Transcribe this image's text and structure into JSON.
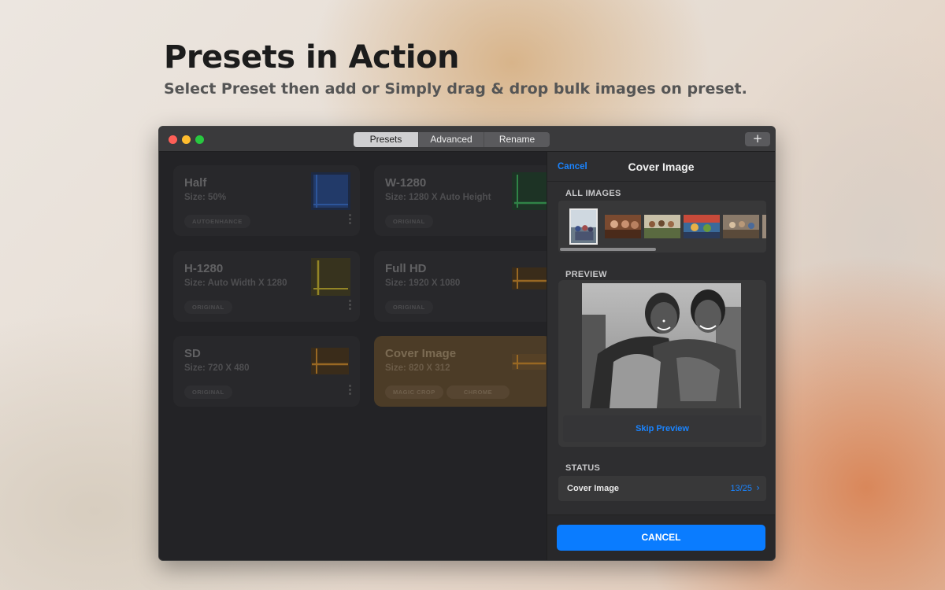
{
  "headline": {
    "title": "Presets in Action",
    "subtitle": "Select Preset then add or Simply drag & drop bulk images on preset."
  },
  "window": {
    "tabs": [
      {
        "label": "Presets",
        "active": true
      },
      {
        "label": "Advanced",
        "active": false
      },
      {
        "label": "Rename",
        "active": false
      }
    ],
    "add_label": "+"
  },
  "presets": [
    {
      "name": "Half",
      "size": "Size: 50%",
      "tags": [
        "AUTOENHANCE"
      ],
      "icon": "scale-half-icon",
      "color": "#2f6fd6"
    },
    {
      "name": "W-1280",
      "size": "Size: 1280 X Auto Height",
      "tags": [
        "ORIGINAL"
      ],
      "icon": "width-fixed-icon",
      "color": "#3aa55a"
    },
    {
      "name": "H-1280",
      "size": "Size: Auto Width X 1280",
      "tags": [
        "ORIGINAL"
      ],
      "icon": "height-fixed-icon",
      "color": "#c9b22e"
    },
    {
      "name": "Full HD",
      "size": "Size: 1920 X 1080",
      "tags": [
        "ORIGINAL"
      ],
      "icon": "crop-icon",
      "color": "#d48a1e"
    },
    {
      "name": "SD",
      "size": "Size: 720 X 480",
      "tags": [
        "ORIGINAL"
      ],
      "icon": "crop-icon",
      "color": "#d48a1e"
    },
    {
      "name": "Cover Image",
      "size": "Size: 820 X 312",
      "tags": [
        "MAGIC CROP",
        "CHROME"
      ],
      "icon": "crop-icon",
      "color": "#d48a1e",
      "selected": true
    }
  ],
  "panel": {
    "cancel_link": "Cancel",
    "title": "Cover Image",
    "all_images_label": "ALL IMAGES",
    "preview_label": "PREVIEW",
    "skip_preview": "Skip Preview",
    "status_label": "STATUS",
    "status_name": "Cover Image",
    "status_count": "13/25",
    "cancel_button": "CANCEL"
  },
  "colors": {
    "accent": "#0a7cff",
    "link": "#1a84ff"
  }
}
